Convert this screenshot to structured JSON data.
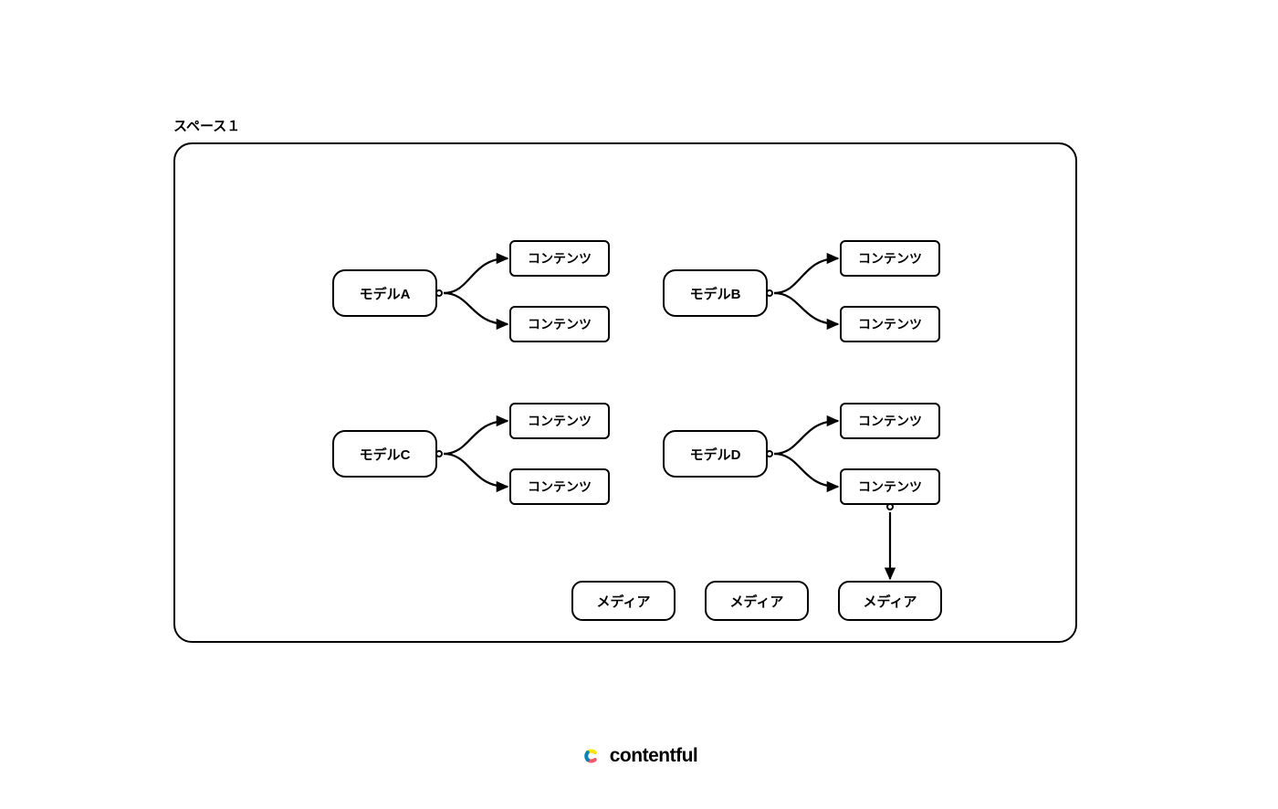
{
  "space": {
    "label": "スペース１"
  },
  "groups": [
    {
      "model": "モデルA",
      "children": [
        "コンテンツ",
        "コンテンツ"
      ]
    },
    {
      "model": "モデルB",
      "children": [
        "コンテンツ",
        "コンテンツ"
      ]
    },
    {
      "model": "モデルC",
      "children": [
        "コンテンツ",
        "コンテンツ"
      ]
    },
    {
      "model": "モデルD",
      "children": [
        "コンテンツ",
        "コンテンツ"
      ]
    }
  ],
  "media": [
    "メディア",
    "メディア",
    "メディア"
  ],
  "brand": {
    "name": "contentful"
  }
}
